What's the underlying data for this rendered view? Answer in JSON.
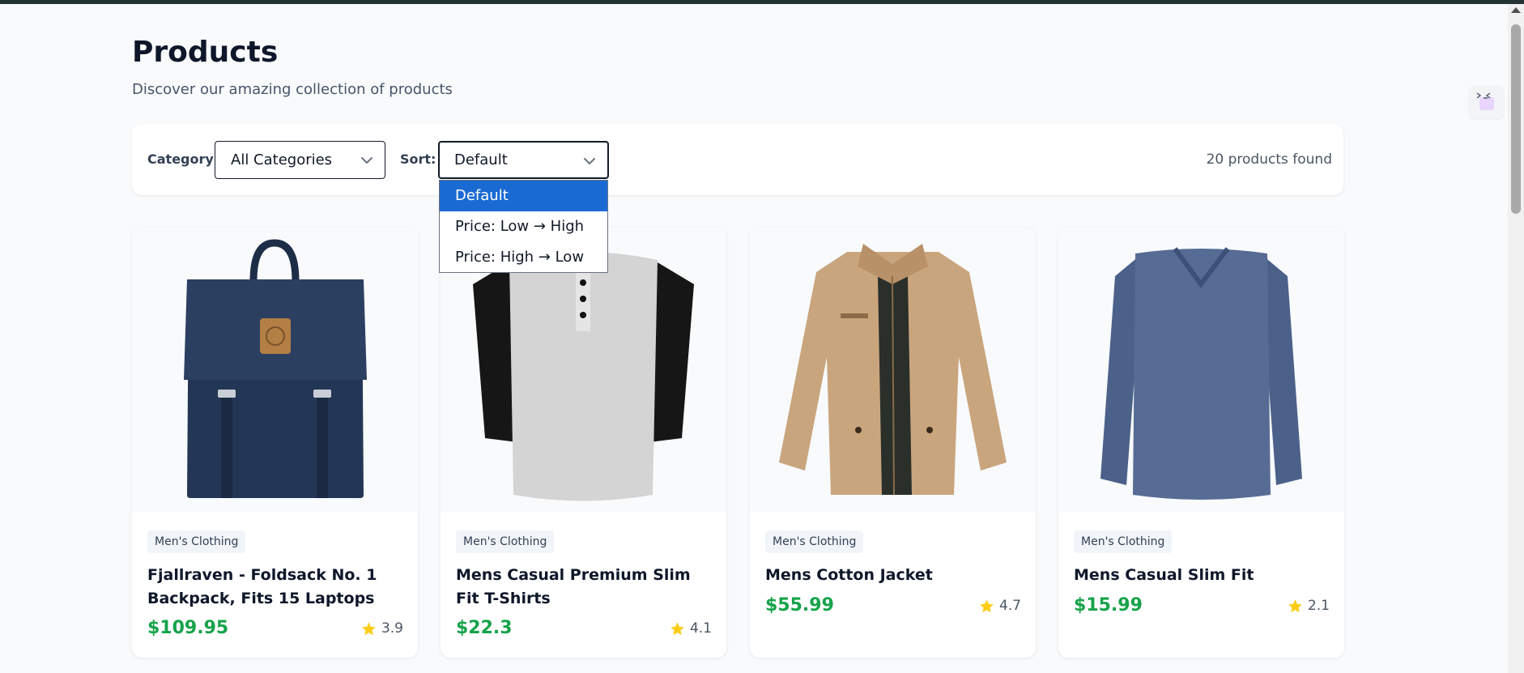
{
  "header": {
    "title": "Products",
    "subtitle": "Discover our amazing collection of products"
  },
  "filters": {
    "category_label": "Category:",
    "category_value": "All Categories",
    "sort_label": "Sort:",
    "sort_value": "Default",
    "sort_options": [
      "Default",
      "Price: Low → High",
      "Price: High → Low"
    ],
    "results_count": "20 products found"
  },
  "products": [
    {
      "category": "Men's Clothing",
      "title": "Fjallraven - Foldsack No. 1 Backpack, Fits 15 Laptops",
      "price": "$109.95",
      "rating": "3.9"
    },
    {
      "category": "Men's Clothing",
      "title": "Mens Casual Premium Slim Fit T-Shirts",
      "price": "$22.3",
      "rating": "4.1"
    },
    {
      "category": "Men's Clothing",
      "title": "Mens Cotton Jacket",
      "price": "$55.99",
      "rating": "4.7"
    },
    {
      "category": "Men's Clothing",
      "title": "Mens Casual Slim Fit",
      "price": "$15.99",
      "rating": "2.1"
    }
  ],
  "colors": {
    "price": "#16a34a",
    "star": "#facc15",
    "dropdown_highlight": "#1a6ad4",
    "top_bar": "#253433"
  },
  "icons": [
    "chevron-down-icon",
    "star-icon",
    "widget-icon"
  ]
}
